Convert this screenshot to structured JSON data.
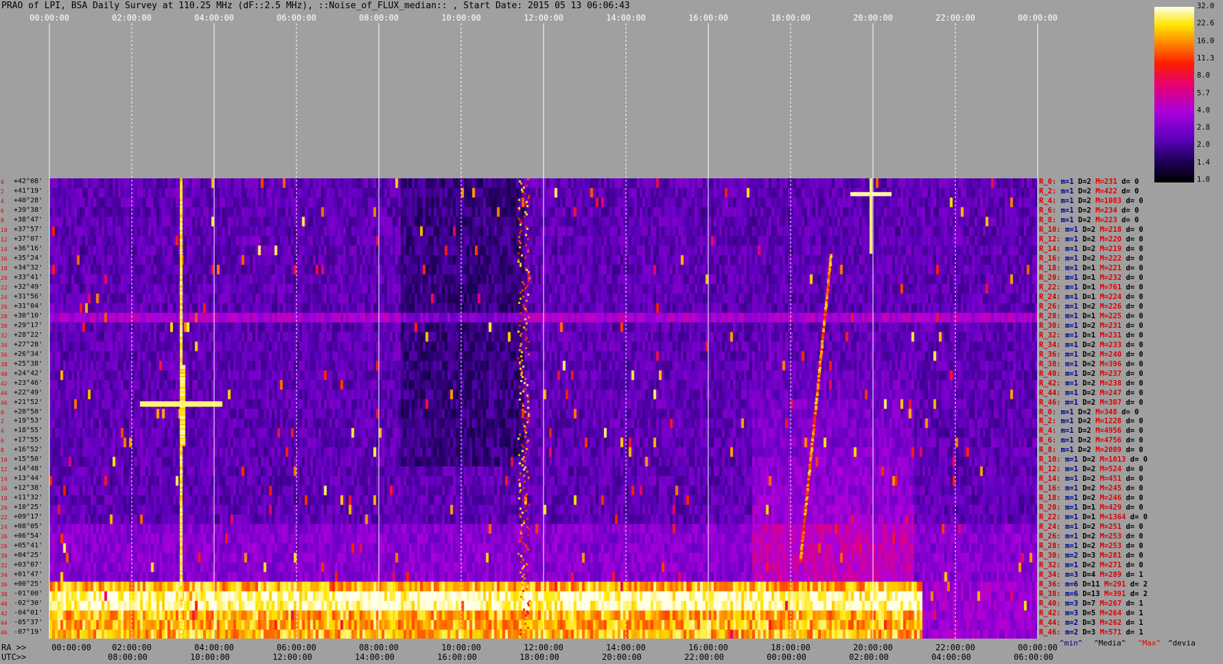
{
  "title": "PRAO of LPI, BSA Daily Survey at 110.25 MHz (dF::2.5 MHz), ::Noise_of_FLUX_median:: , Start Date: 2015 05 13 06:06:43",
  "top_ticks": [
    "00:00:00",
    "02:00:00",
    "04:00:00",
    "06:00:00",
    "08:00:00",
    "10:00:00",
    "12:00:00",
    "14:00:00",
    "16:00:00",
    "18:00:00",
    "20:00:00",
    "22:00:00",
    "00:00:00"
  ],
  "bottom_ra_prefix": "RA >>",
  "bottom_ra_ticks": [
    "00:00:00",
    "02:00:00",
    "04:00:00",
    "06:00:00",
    "08:00:00",
    "10:00:00",
    "12:00:00",
    "14:00:00",
    "16:00:00",
    "18:00:00",
    "20:00:00",
    "22:00:00",
    "00:00:00"
  ],
  "bottom_utc_prefix": "UTC>>",
  "bottom_utc_ticks": [
    "08:00:00",
    "10:00:00",
    "12:00:00",
    "14:00:00",
    "16:00:00",
    "18:00:00",
    "20:00:00",
    "22:00:00",
    "00:00:00",
    "02:00:00",
    "04:00:00",
    "06:00:00"
  ],
  "colorbar_labels": [
    "32.0",
    "22.6",
    "16.0",
    "11.3",
    "8.0",
    "5.7",
    "4.0",
    "2.8",
    "2.0",
    "1.4",
    "1.0"
  ],
  "legend": {
    "min": "^min^",
    "media": "^Media^",
    "max": "^Max^",
    "devia": "^devia"
  },
  "declinations": [
    "+42°08'",
    "+41°19'",
    "+40°28'",
    "+39°38'",
    "+38°47'",
    "+37°57'",
    "+37°07'",
    "+36°16'",
    "+35°24'",
    "+34°32'",
    "+33°41'",
    "+32°49'",
    "+31°56'",
    "+31°04'",
    "+30°10'",
    "+29°17'",
    "+28°22'",
    "+27°28'",
    "+26°34'",
    "+25°38'",
    "+24°42'",
    "+23°46'",
    "+22°49'",
    "+21°52'",
    "+20°50'",
    "+19°53'",
    "+18°55'",
    "+17°55'",
    "+16°52'",
    "+15°50'",
    "+14°48'",
    "+13°44'",
    "+12°38'",
    "+11°32'",
    "+10°25'",
    "+09°17'",
    "+08°05'",
    "+06°54'",
    "+05°41'",
    "+04°25'",
    "+03°07'",
    "+01°47'",
    "+00°25'",
    "-01°00'",
    "-02°30'",
    "-04°01'",
    "-05°37'",
    "-07°19'"
  ],
  "row_stats": [
    {
      "r": "R_0:",
      "m": "m=1",
      "D": "D=2",
      "M": "M=231",
      "d": "d= 0"
    },
    {
      "r": "R_2:",
      "m": "m=1",
      "D": "D=2",
      "M": "M=422",
      "d": "d= 0"
    },
    {
      "r": "R_4:",
      "m": "m=1",
      "D": "D=2",
      "M": "M=1083",
      "d": "d= 0"
    },
    {
      "r": "R_6:",
      "m": "m=1",
      "D": "D=2",
      "M": "M=234",
      "d": "d= 0"
    },
    {
      "r": "R_8:",
      "m": "m=1",
      "D": "D=2",
      "M": "M=223",
      "d": "d= 0"
    },
    {
      "r": "R_10:",
      "m": "m=1",
      "D": "D=2",
      "M": "M=218",
      "d": "d= 0"
    },
    {
      "r": "R_12:",
      "m": "m=1",
      "D": "D=2",
      "M": "M=220",
      "d": "d= 0"
    },
    {
      "r": "R_14:",
      "m": "m=1",
      "D": "D=2",
      "M": "M=219",
      "d": "d= 0"
    },
    {
      "r": "R_16:",
      "m": "m=1",
      "D": "D=2",
      "M": "M=222",
      "d": "d= 0"
    },
    {
      "r": "R_18:",
      "m": "m=1",
      "D": "D=1",
      "M": "M=221",
      "d": "d= 0"
    },
    {
      "r": "R_20:",
      "m": "m=1",
      "D": "D=1",
      "M": "M=232",
      "d": "d= 0"
    },
    {
      "r": "R_22:",
      "m": "m=1",
      "D": "D=1",
      "M": "M=761",
      "d": "d= 0"
    },
    {
      "r": "R_24:",
      "m": "m=1",
      "D": "D=1",
      "M": "M=224",
      "d": "d= 0"
    },
    {
      "r": "R_26:",
      "m": "m=1",
      "D": "D=2",
      "M": "M=226",
      "d": "d= 0"
    },
    {
      "r": "R_28:",
      "m": "m=1",
      "D": "D=1",
      "M": "M=225",
      "d": "d= 0"
    },
    {
      "r": "R_30:",
      "m": "m=1",
      "D": "D=2",
      "M": "M=231",
      "d": "d= 0"
    },
    {
      "r": "R_32:",
      "m": "m=1",
      "D": "D=1",
      "M": "M=231",
      "d": "d= 0"
    },
    {
      "r": "R_34:",
      "m": "m=1",
      "D": "D=2",
      "M": "M=233",
      "d": "d= 0"
    },
    {
      "r": "R_36:",
      "m": "m=1",
      "D": "D=2",
      "M": "M=240",
      "d": "d= 0"
    },
    {
      "r": "R_38:",
      "m": "m=1",
      "D": "D=2",
      "M": "M=396",
      "d": "d= 0"
    },
    {
      "r": "R_40:",
      "m": "m=1",
      "D": "D=2",
      "M": "M=237",
      "d": "d= 0"
    },
    {
      "r": "R_42:",
      "m": "m=1",
      "D": "D=2",
      "M": "M=238",
      "d": "d= 0"
    },
    {
      "r": "R_44:",
      "m": "m=1",
      "D": "D=2",
      "M": "M=247",
      "d": "d= 0"
    },
    {
      "r": "R_46:",
      "m": "m=1",
      "D": "D=2",
      "M": "M=307",
      "d": "d= 0"
    },
    {
      "r": "R_0:",
      "m": "m=1",
      "D": "D=2",
      "M": "M=348",
      "d": "d= 0"
    },
    {
      "r": "R_2:",
      "m": "m=1",
      "D": "D=2",
      "M": "M=1228",
      "d": "d= 0"
    },
    {
      "r": "R_4:",
      "m": "m=1",
      "D": "D=2",
      "M": "M=4956",
      "d": "d= 0"
    },
    {
      "r": "R_6:",
      "m": "m=1",
      "D": "D=2",
      "M": "M=4756",
      "d": "d= 0"
    },
    {
      "r": "R_8:",
      "m": "m=1",
      "D": "D=2",
      "M": "M=2089",
      "d": "d= 0"
    },
    {
      "r": "R_10:",
      "m": "m=1",
      "D": "D=2",
      "M": "M=1013",
      "d": "d= 0"
    },
    {
      "r": "R_12:",
      "m": "m=1",
      "D": "D=2",
      "M": "M=524",
      "d": "d= 0"
    },
    {
      "r": "R_14:",
      "m": "m=1",
      "D": "D=2",
      "M": "M=451",
      "d": "d= 0"
    },
    {
      "r": "R_16:",
      "m": "m=1",
      "D": "D=2",
      "M": "M=245",
      "d": "d= 0"
    },
    {
      "r": "R_18:",
      "m": "m=1",
      "D": "D=2",
      "M": "M=246",
      "d": "d= 0"
    },
    {
      "r": "R_20:",
      "m": "m=1",
      "D": "D=1",
      "M": "M=429",
      "d": "d= 0"
    },
    {
      "r": "R_22:",
      "m": "m=1",
      "D": "D=1",
      "M": "M=1364",
      "d": "d= 0"
    },
    {
      "r": "R_24:",
      "m": "m=1",
      "D": "D=2",
      "M": "M=251",
      "d": "d= 0"
    },
    {
      "r": "R_26:",
      "m": "m=1",
      "D": "D=2",
      "M": "M=253",
      "d": "d= 0"
    },
    {
      "r": "R_28:",
      "m": "m=1",
      "D": "D=2",
      "M": "M=253",
      "d": "d= 0"
    },
    {
      "r": "R_30:",
      "m": "m=2",
      "D": "D=3",
      "M": "M=281",
      "d": "d= 0"
    },
    {
      "r": "R_32:",
      "m": "m=1",
      "D": "D=2",
      "M": "M=271",
      "d": "d= 0"
    },
    {
      "r": "R_34:",
      "m": "m=3",
      "D": "D=4",
      "M": "M=289",
      "d": "d= 1"
    },
    {
      "r": "R_36:",
      "m": "m=6",
      "D": "D=11",
      "M": "M=291",
      "d": "d= 2"
    },
    {
      "r": "R_38:",
      "m": "m=6",
      "D": "D=13",
      "M": "M=391",
      "d": "d= 2"
    },
    {
      "r": "R_40:",
      "m": "m=3",
      "D": "D=7",
      "M": "M=267",
      "d": "d= 1"
    },
    {
      "r": "R_42:",
      "m": "m=3",
      "D": "D=5",
      "M": "M=264",
      "d": "d= 1"
    },
    {
      "r": "R_44:",
      "m": "m=2",
      "D": "D=3",
      "M": "M=262",
      "d": "d= 1"
    },
    {
      "r": "R_46:",
      "m": "m=2",
      "D": "D=3",
      "M": "M=571",
      "d": "d= 1"
    }
  ],
  "row_numbers": [
    "0",
    "2",
    "4",
    "6",
    "8",
    "10",
    "12",
    "14",
    "16",
    "18",
    "20",
    "22",
    "24",
    "26",
    "28",
    "30",
    "32",
    "34",
    "36",
    "38",
    "40",
    "42",
    "44",
    "46",
    "0",
    "2",
    "4",
    "6",
    "8",
    "10",
    "12",
    "14",
    "16",
    "18",
    "20",
    "22",
    "24",
    "26",
    "28",
    "30",
    "32",
    "34",
    "36",
    "38",
    "40",
    "42",
    "44",
    "46"
  ],
  "colors": {
    "background": "#a0a0a0",
    "grid": "#ffffff",
    "stat_label": "#d00000",
    "stat_min": "#00008a",
    "stat_max": "#e00000"
  },
  "chart_data": {
    "type": "heatmap",
    "title": "PRAO of LPI, BSA Daily Survey at 110.25 MHz (dF::2.5 MHz), ::Noise_of_FLUX_median:: , Start Date: 2015 05 13 06:06:43",
    "x_axis": "RA / UTC (hh:mm:ss)",
    "y_axis": "Declination",
    "rows": 48,
    "colorbar": {
      "scale": "log",
      "range": [
        1.0,
        32.0
      ],
      "ticks": [
        1.0,
        1.4,
        2.0,
        2.8,
        4.0,
        5.7,
        8.0,
        11.3,
        16.0,
        22.6,
        32.0
      ]
    },
    "features": [
      {
        "ra_h": 3.2,
        "note": "Cassiopeia A-like bright source"
      },
      {
        "ra_h": 19.95,
        "note": "Cygnus A-like bright source"
      },
      {
        "ra_h": 11.5,
        "note": "vertical interference streak"
      },
      {
        "dec_range": [
          "+01°47'",
          "-07°19'"
        ],
        "note": "bright low-declination band"
      }
    ]
  }
}
